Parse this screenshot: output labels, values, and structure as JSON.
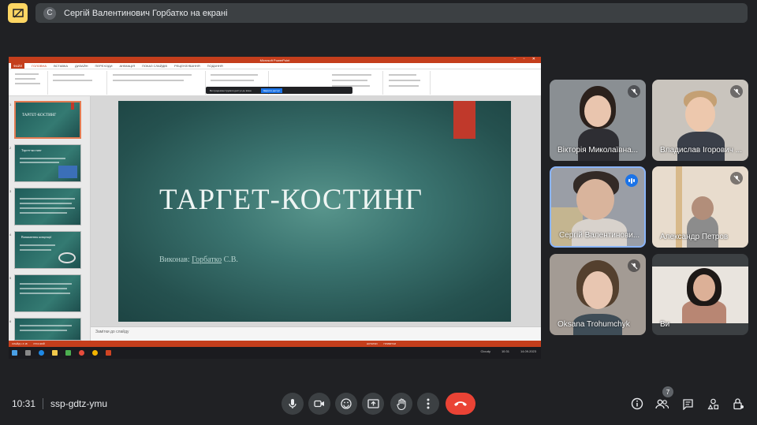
{
  "banner": {
    "avatar_letter": "С",
    "text": "Сергій Валентинович Горбатко на екрані"
  },
  "shared_screen": {
    "window_title": "Microsoft PowerPoint",
    "ribbon_tabs": [
      "ФАЙЛ",
      "ГОЛОВНА",
      "ВСТАВКА",
      "ДИЗАЙН",
      "ПЕРЕХОДИ",
      "АНІМАЦІЯ",
      "ПОКАЗ СЛАЙДІВ",
      "РЕЦЕНЗУВАННЯ",
      "ПОДАННЯ"
    ],
    "active_tab": "ГОЛОВНА",
    "notification": "Ви продемонструвати доступ до вікна",
    "notification_button": "Закрити доступ",
    "thumbnails": [
      {
        "num": "1",
        "title": "ТАРГЕТ-КОСТИНГ"
      },
      {
        "num": "2",
        "title": "Таргет-костинг"
      },
      {
        "num": "3",
        "title": ""
      },
      {
        "num": "4",
        "title": "Виникнення концепції"
      },
      {
        "num": "5",
        "title": ""
      },
      {
        "num": "6",
        "title": ""
      }
    ],
    "slide": {
      "title": "ТАРГЕТ-КОСТИНГ",
      "subtitle_prefix": "Виконав: ",
      "subtitle_name": "Горбатко",
      "subtitle_suffix": " С.В."
    },
    "notes_placeholder": "Замітки до слайду",
    "status_left": "СЛАЙД 1 З 18",
    "status_lang": "РУССКИЙ",
    "status_notes": "НОТАТКИ",
    "status_comments": "ПРИМІТКИ",
    "weather": "Cloudy",
    "time": "10:31",
    "date": "14.09.2023"
  },
  "participants": [
    {
      "name": "Вікторія Миколаївна...",
      "muted": true
    },
    {
      "name": "Владислав Ігорович ...",
      "muted": true
    },
    {
      "name": "Сергій Валентинови...",
      "muted": false,
      "speaking": true
    },
    {
      "name": "Александр Петров",
      "muted": true
    },
    {
      "name": "Oksana Trohumchyk",
      "muted": true
    },
    {
      "name": "Ви",
      "muted": false
    }
  ],
  "meeting": {
    "time": "10:31",
    "code": "ssp-gdtz-ymu",
    "participant_count": "7"
  },
  "icons": {
    "controls": [
      "mic-icon",
      "camera-icon",
      "emoji-icon",
      "present-icon",
      "hand-icon",
      "more-icon",
      "end-call-icon"
    ],
    "right": [
      "info-icon",
      "people-icon",
      "chat-icon",
      "activities-icon",
      "lock-icon"
    ]
  },
  "colors": {
    "meet_bg": "#202124",
    "end_call": "#ea4335",
    "speaking": "#1a73e8",
    "ppt_accent": "#c43e1c",
    "slide_teal": "#3b7470"
  }
}
